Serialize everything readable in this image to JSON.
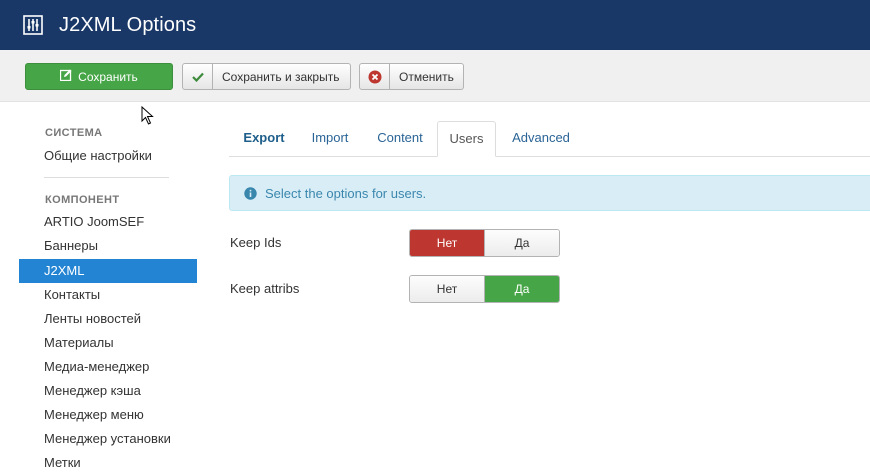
{
  "header": {
    "title": "J2XML Options",
    "icon": "settings-sliders-icon",
    "bg_color": "#1a3867"
  },
  "toolbar": {
    "save_label": "Сохранить",
    "save_close_label": "Сохранить и закрыть",
    "cancel_label": "Отменить"
  },
  "sidebar": {
    "system_heading": "СИСТЕМА",
    "system_items": [
      "Общие настройки"
    ],
    "component_heading": "КОМПОНЕНТ",
    "items": [
      "ARTIO JoomSEF",
      "Баннеры",
      "J2XML",
      "Контакты",
      "Ленты новостей",
      "Материалы",
      "Медиа-менеджер",
      "Менеджер кэша",
      "Менеджер меню",
      "Менеджер установки",
      "Метки"
    ],
    "active_item": "J2XML",
    "active_color": "#2384d3"
  },
  "tabs": [
    {
      "label": "Export"
    },
    {
      "label": "Import"
    },
    {
      "label": "Content"
    },
    {
      "label": "Users"
    },
    {
      "label": "Advanced"
    }
  ],
  "active_tab": "Users",
  "alert": {
    "text": "Select the options for users."
  },
  "fields": [
    {
      "label": "Keep Ids",
      "no": "Нет",
      "yes": "Да",
      "selected": "Нет"
    },
    {
      "label": "Keep attribs",
      "no": "Нет",
      "yes": "Да",
      "selected": "Да"
    }
  ],
  "colors": {
    "save_green": "#46a546",
    "no_red": "#bd362f",
    "yes_green": "#46a546",
    "alert_bg": "#d9edf7"
  }
}
